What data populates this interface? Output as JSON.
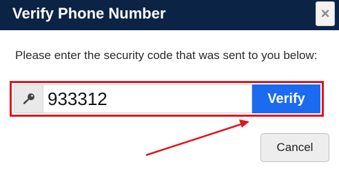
{
  "dialog": {
    "title": "Verify Phone Number",
    "close_label": "×",
    "instructions": "Please enter the security code that was sent to you below:",
    "code_value": "933312",
    "verify_label": "Verify",
    "cancel_label": "Cancel"
  },
  "icons": {
    "addon_icon": "key-icon"
  },
  "colors": {
    "header_bg": "#0b2446",
    "accent": "#1a6bf0",
    "highlight": "#e2141c"
  }
}
